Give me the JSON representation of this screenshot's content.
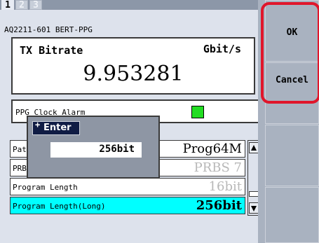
{
  "tabs": [
    {
      "label": "1"
    },
    {
      "label": "2"
    },
    {
      "label": "3"
    }
  ],
  "device_name": "AQ2211-601 BERT-PPG",
  "tx_bitrate": {
    "label": "TX Bitrate",
    "unit": "Gbit/s",
    "value": "9.953281"
  },
  "ppg_clock_alarm": {
    "label": "PPG Clock Alarm",
    "led_color": "#22dd22"
  },
  "list": [
    {
      "label": "Pattern",
      "value": "Prog64M",
      "style": "normal"
    },
    {
      "label": "PRBS",
      "value": "PRBS 7",
      "style": "dim"
    },
    {
      "label": "Program Length",
      "value": "16bit",
      "style": "dim"
    },
    {
      "label": "Program Length(Long)",
      "value": "256bit",
      "style": "selected"
    }
  ],
  "popup": {
    "title": "Enter",
    "input_value": "256bit"
  },
  "softkeys": {
    "ok": "OK",
    "cancel": "Cancel"
  },
  "colors": {
    "selection": "#00ffff",
    "highlight_ring": "#e0162b",
    "popup_title_bg": "#101c44"
  }
}
